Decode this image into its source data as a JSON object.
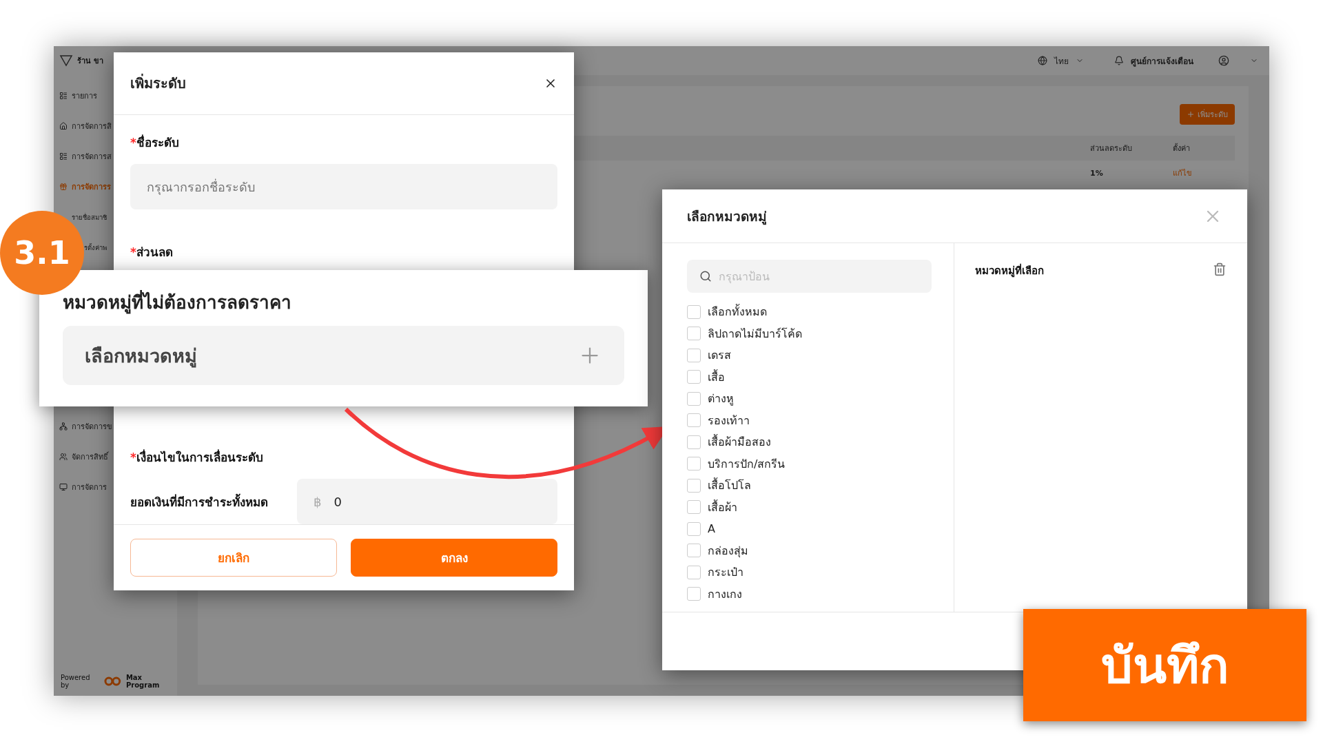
{
  "app": {
    "brand": "ร้าน ขา",
    "sidebar_top": [
      {
        "label": "รายการ",
        "kind": "main",
        "selected": false
      },
      {
        "label": "การจัดการสิ",
        "kind": "main",
        "selected": false
      },
      {
        "label": "การจัดการส",
        "kind": "main",
        "selected": false
      },
      {
        "label": "การจัดการร",
        "kind": "main",
        "selected": true
      },
      {
        "label": "รายชื่อสมาชิ",
        "kind": "sub",
        "selected": false
      },
      {
        "label": "รตั้งค่าพ",
        "kind": "sub",
        "selected": false
      }
    ],
    "sidebar_bottom": [
      {
        "label": "การจัดการข",
        "kind": "main",
        "selected": false
      },
      {
        "label": "จัดการสิทธิ์",
        "kind": "main",
        "selected": false
      },
      {
        "label": "การจัดการ",
        "kind": "main",
        "selected": false
      }
    ],
    "powered_by": "Powered by",
    "powered_brand": "Max Program",
    "header": {
      "language": "ไทย",
      "notifications": "ศูนย์การแจ้งเตือน"
    },
    "add_button": "เพิ่มระดับ",
    "table": {
      "columns": [
        "ส่วนลดระดับ",
        "ตั้งค่า"
      ],
      "rows": [
        {
          "discount": "1%",
          "action": "แก้ไข"
        }
      ]
    }
  },
  "add_level_dialog": {
    "title": "เพิ่มระดับ",
    "required_mark": "*",
    "fields": [
      {
        "label": "ชื่อระดับ",
        "required": true,
        "placeholder": "กรุณากรอกชื่อระดับ"
      },
      {
        "label": "ส่วนลด",
        "required": true
      }
    ],
    "condition_label": "เงื่อนไขในการเลื่อนระดับ",
    "condition_required": true,
    "amount_label": "ยอดเงินที่มีการชำระทั้งหมด",
    "currency": "฿",
    "amount_value": "0",
    "buttons": [
      "ยกเลิก",
      "ตกลง"
    ]
  },
  "callout": {
    "step": "3.1",
    "title": "หมวดหมู่ที่ไม่ต้องการลดราคา",
    "picker": "เลือกหมวดหมู่"
  },
  "category_dialog": {
    "title": "เลือกหมวดหมู่",
    "search_placeholder": "กรุณาป้อน",
    "options": [
      {
        "label": "เลือกทั้งหมด",
        "checked": false
      },
      {
        "label": "ลิปถาดไม่มีบาร์โค้ด",
        "checked": false
      },
      {
        "label": "เดรส",
        "checked": false
      },
      {
        "label": "เสื้อ",
        "checked": false
      },
      {
        "label": "ต่างหู",
        "checked": false
      },
      {
        "label": "รองเท้าา",
        "checked": false
      },
      {
        "label": "เสื้อผ้ามือสอง",
        "checked": false
      },
      {
        "label": "บริการปัก/สกรีน",
        "checked": false
      },
      {
        "label": "เสื้อโปโล",
        "checked": false
      },
      {
        "label": "เสื้อผ้า",
        "checked": false
      },
      {
        "label": "A",
        "checked": false
      },
      {
        "label": "กล่องสุ่ม",
        "checked": false
      },
      {
        "label": "กระเป๋า",
        "checked": false
      },
      {
        "label": "กางเกง",
        "checked": false
      }
    ],
    "selected_title": "หมวดหมู่ที่เลือก"
  },
  "save_button": "บันทึก"
}
